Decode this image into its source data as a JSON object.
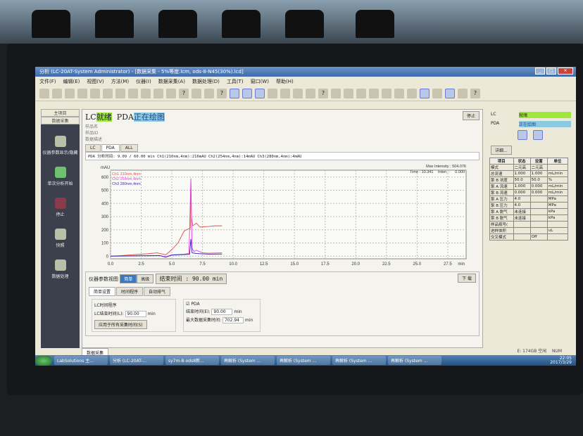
{
  "window": {
    "title": "分析 (LC-20AT-System Administrator) - [数据采集 - 5%等度.lcm, ods-8-N45(30%).lcd]"
  },
  "menu": [
    "文件(F)",
    "编辑(E)",
    "视图(V)",
    "方法(M)",
    "仪器(I)",
    "数据采集(A)",
    "数据处理(D)",
    "工具(T)",
    "窗口(W)",
    "帮助(H)"
  ],
  "sidebar": {
    "top": [
      "主项目",
      "数据采集"
    ],
    "items": [
      {
        "label": "仪器参数显示/隐藏",
        "icon": "instrument-icon"
      },
      {
        "label": "单次分析开始",
        "icon": "start-icon"
      },
      {
        "label": "停止",
        "icon": "stop-icon"
      },
      {
        "label": "快照",
        "icon": "snapshot-icon"
      },
      {
        "label": "数据处理",
        "icon": "data-processing-icon"
      }
    ]
  },
  "status": {
    "lc_label": "LC",
    "lc_state": "就绪",
    "pda_label": "PDA",
    "pda_state": "正在绘图",
    "stop_button": "停止",
    "sample_name": "样品名",
    "sample_id": "样品ID",
    "data_desc": "数据描述"
  },
  "tabs": [
    "LC",
    "PDA",
    "ALL"
  ],
  "channel_line": "PDA 分析时间: 9.09 / 60.00 min Ch1(210nm,4nm):216mAU Ch2(254nm,4nm):14mAU Ch3(280nm,4nm):4mAU",
  "plot": {
    "max_intensity": "Max Intensity : 504.076",
    "time": "Time : 10.341",
    "inten": "Inten. :",
    "inten_value": "0.000"
  },
  "chart_data": {
    "type": "line",
    "ylabel": "mAU",
    "xlabel": "min",
    "xlim": [
      0,
      29
    ],
    "ylim": [
      -20,
      620
    ],
    "x_ticks": [
      "0.0",
      "2.5",
      "5.0",
      "7.5",
      "10.0",
      "12.5",
      "15.0",
      "17.5",
      "20.0",
      "22.5",
      "25.0",
      "27.5"
    ],
    "y_ticks": [
      "0",
      "100",
      "200",
      "300",
      "400",
      "500",
      "600"
    ],
    "grid": true,
    "legend": "top-left",
    "series": [
      {
        "name": "Ch1 210nm,4nm",
        "color": "#e05050",
        "x": [
          0,
          1,
          2,
          3,
          3.8,
          4.5,
          5,
          5.5,
          6,
          6.3,
          6.5,
          6.55,
          6.6,
          6.7,
          7,
          7.3,
          7.5,
          8,
          8.5,
          9.09
        ],
        "y": [
          0,
          5,
          12,
          18,
          25,
          10,
          50,
          100,
          190,
          205,
          210,
          570,
          300,
          230,
          250,
          220,
          222,
          225,
          230,
          230
        ]
      },
      {
        "name": "Ch2 254nm,4nm",
        "color": "#e040e0",
        "x": [
          0,
          2,
          4,
          4.5,
          5,
          6,
          6.4,
          6.55,
          6.65,
          6.8,
          7,
          7.5,
          8,
          9.09
        ],
        "y": [
          0,
          3,
          5,
          -5,
          10,
          15,
          20,
          590,
          60,
          35,
          45,
          25,
          22,
          25
        ]
      },
      {
        "name": "Ch3 280nm,4nm",
        "color": "#3030c0",
        "x": [
          0,
          2,
          4,
          4.5,
          5,
          6,
          6.45,
          6.55,
          6.65,
          7,
          8,
          9.09
        ],
        "y": [
          0,
          2,
          4,
          -8,
          8,
          12,
          15,
          130,
          25,
          20,
          15,
          16
        ]
      }
    ]
  },
  "params": {
    "title": "仪器参数视图",
    "mode_simple": "简单",
    "mode_advanced": "高级",
    "end_time_banner": "结束时间 : 90.00 min",
    "download": "下 载",
    "subtabs": [
      "简单设置",
      "时间程序",
      "自动排气"
    ],
    "lc_group": "LC时间程序",
    "lc_end_label": "LC结束时间(L):",
    "lc_end_value": "90.00",
    "unit": "min",
    "apply_button": "应用于所有采集时间(S)",
    "pda_check": "PDA",
    "pda_end_label": "结束时间(E):",
    "pda_end_value": "90.00",
    "max_time_label": "最大数据采集时间:",
    "max_time_value": "702.94"
  },
  "right": {
    "detail_button": "详细...",
    "headers": [
      "项目",
      "状态",
      "设置",
      "单位"
    ],
    "rows": [
      [
        "模式",
        "二元高",
        "二元高",
        ""
      ],
      [
        "总流速",
        "1.000",
        "1.000",
        "mL/min"
      ],
      [
        "泵 B 浓度",
        "50.0",
        "50.0",
        "%"
      ],
      [
        "泵 A 流速",
        "1.000",
        "0.000",
        "mL/min"
      ],
      [
        "泵 B 流速",
        "0.000",
        "0.000",
        "mL/min"
      ],
      [
        "泵 A 压力",
        "4.0",
        "",
        "MPa"
      ],
      [
        "泵 B 压力",
        "4.0",
        "",
        "MPa"
      ],
      [
        "泵 A 脱气",
        "未连接",
        "",
        "kPa"
      ],
      [
        "泵 B 脱气",
        "未连接",
        "",
        "kPa"
      ],
      [
        "样品瓶号(",
        "",
        "",
        ""
      ],
      [
        "进样体积",
        "",
        "",
        "uL"
      ],
      [
        "交叉模式",
        "",
        "Off",
        ""
      ]
    ]
  },
  "bottom_tab": "数据采集",
  "statusbar": {
    "disk": "E: 174GB 空闲",
    "num": "NUM"
  },
  "taskbar": {
    "items": [
      "LabSolutions 主...",
      "分析 (LC-20AT-...",
      "sy7m-8-ods8新...",
      "再解析 (System ...",
      "再解析 (System ...",
      "再解析 (System ...",
      "再解析 (System ..."
    ],
    "time": "22:05",
    "date": "2017/3/29"
  }
}
